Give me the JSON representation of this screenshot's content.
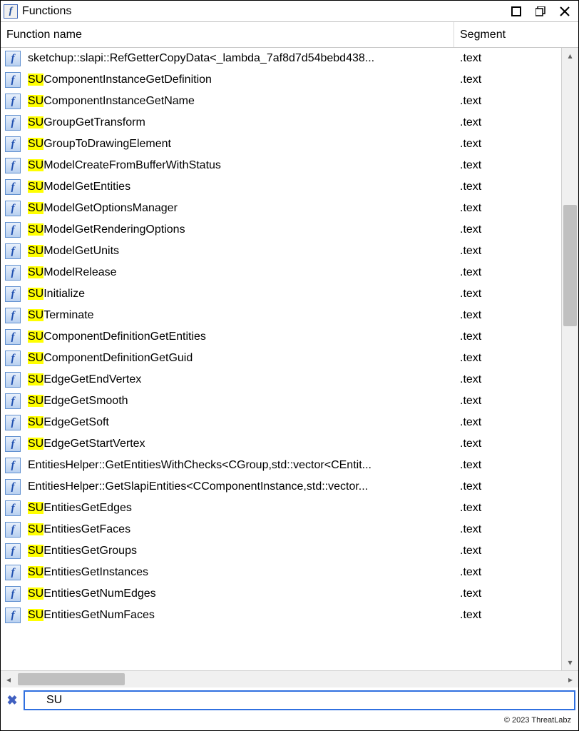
{
  "window": {
    "title": "Functions"
  },
  "columns": {
    "name": "Function name",
    "segment": "Segment"
  },
  "filter": {
    "value": "SU",
    "highlight": "SU"
  },
  "rows": [
    {
      "name": "sketchup::slapi::RefGetterCopyData<_lambda_7af8d7d54bebd438...",
      "segment": ".text"
    },
    {
      "name": "SUComponentInstanceGetDefinition",
      "segment": ".text"
    },
    {
      "name": "SUComponentInstanceGetName",
      "segment": ".text"
    },
    {
      "name": "SUGroupGetTransform",
      "segment": ".text"
    },
    {
      "name": "SUGroupToDrawingElement",
      "segment": ".text"
    },
    {
      "name": "SUModelCreateFromBufferWithStatus",
      "segment": ".text"
    },
    {
      "name": "SUModelGetEntities",
      "segment": ".text"
    },
    {
      "name": "SUModelGetOptionsManager",
      "segment": ".text"
    },
    {
      "name": "SUModelGetRenderingOptions",
      "segment": ".text"
    },
    {
      "name": "SUModelGetUnits",
      "segment": ".text"
    },
    {
      "name": "SUModelRelease",
      "segment": ".text"
    },
    {
      "name": "SUInitialize",
      "segment": ".text"
    },
    {
      "name": "SUTerminate",
      "segment": ".text"
    },
    {
      "name": "SUComponentDefinitionGetEntities",
      "segment": ".text"
    },
    {
      "name": "SUComponentDefinitionGetGuid",
      "segment": ".text"
    },
    {
      "name": "SUEdgeGetEndVertex",
      "segment": ".text"
    },
    {
      "name": "SUEdgeGetSmooth",
      "segment": ".text"
    },
    {
      "name": "SUEdgeGetSoft",
      "segment": ".text"
    },
    {
      "name": "SUEdgeGetStartVertex",
      "segment": ".text"
    },
    {
      "name": "EntitiesHelper::GetEntitiesWithChecks<CGroup,std::vector<CEntit...",
      "segment": ".text"
    },
    {
      "name": "EntitiesHelper::GetSlapiEntities<CComponentInstance,std::vector...",
      "segment": ".text"
    },
    {
      "name": "SUEntitiesGetEdges",
      "segment": ".text"
    },
    {
      "name": "SUEntitiesGetFaces",
      "segment": ".text"
    },
    {
      "name": "SUEntitiesGetGroups",
      "segment": ".text"
    },
    {
      "name": "SUEntitiesGetInstances",
      "segment": ".text"
    },
    {
      "name": "SUEntitiesGetNumEdges",
      "segment": ".text"
    },
    {
      "name": "SUEntitiesGetNumFaces",
      "segment": ".text"
    }
  ],
  "footer": {
    "copyright": "© 2023 ThreatLabz"
  }
}
